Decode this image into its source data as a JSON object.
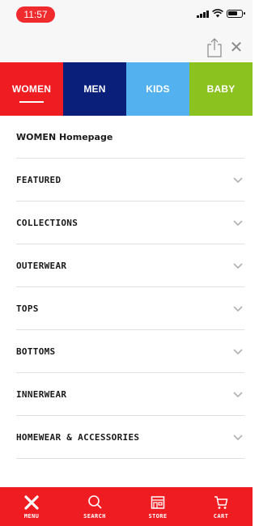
{
  "status": {
    "time": "11:57"
  },
  "tabs": [
    {
      "label": "WOMEN",
      "color": "#ef1c22",
      "active": true
    },
    {
      "label": "MEN",
      "color": "#0a1f7a",
      "active": false
    },
    {
      "label": "KIDS",
      "color": "#52b1ee",
      "active": false
    },
    {
      "label": "BABY",
      "color": "#8cc21f",
      "active": false
    }
  ],
  "menu": [
    {
      "label": "WOMEN Homepage",
      "chevron": false
    },
    {
      "label": "FEATURED",
      "chevron": true
    },
    {
      "label": "COLLECTIONS",
      "chevron": true
    },
    {
      "label": "OUTERWEAR",
      "chevron": true
    },
    {
      "label": "TOPS",
      "chevron": true
    },
    {
      "label": "BOTTOMS",
      "chevron": true
    },
    {
      "label": "INNERWEAR",
      "chevron": true
    },
    {
      "label": "HOMEWEAR & ACCESSORIES",
      "chevron": true
    }
  ],
  "bottom_nav": [
    {
      "label": "MENU",
      "icon": "close-icon"
    },
    {
      "label": "SEARCH",
      "icon": "search-icon"
    },
    {
      "label": "STORE",
      "icon": "store-icon"
    },
    {
      "label": "CART",
      "icon": "cart-icon"
    }
  ],
  "colors": {
    "brand_red": "#ef1c22",
    "chevron": "#b0b0b0"
  }
}
